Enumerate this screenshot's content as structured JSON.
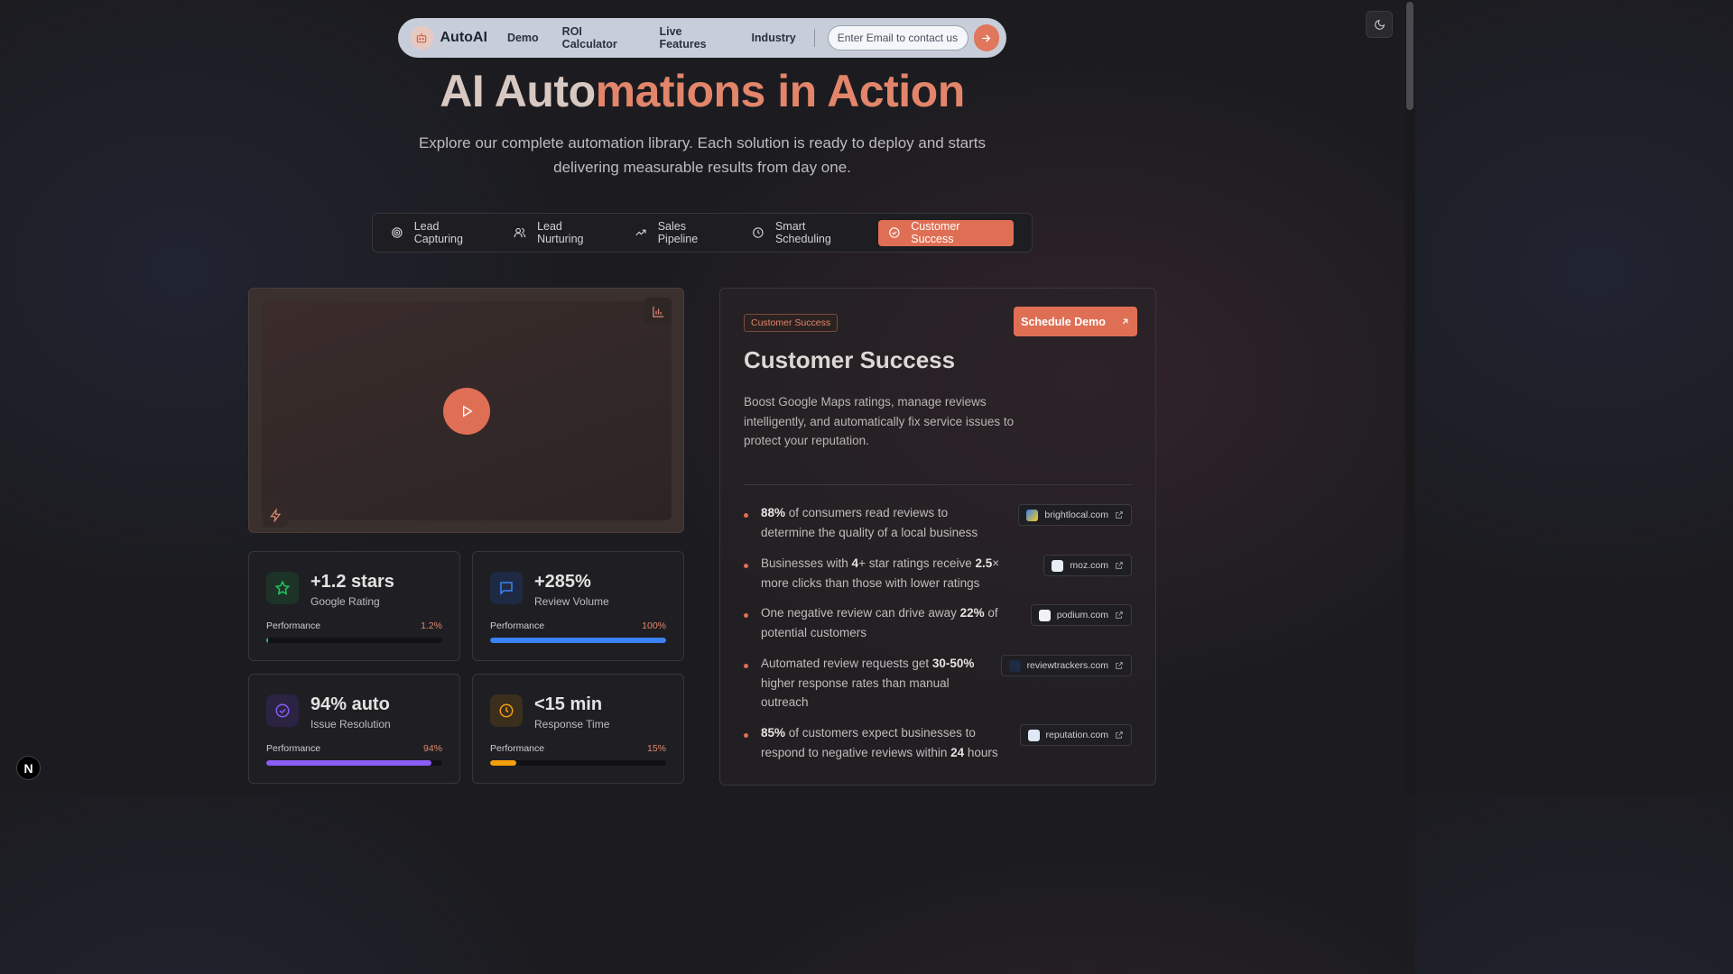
{
  "nav": {
    "brand": "AutoAI",
    "links": [
      "Demo",
      "ROI Calculator",
      "Live Features",
      "Industry"
    ],
    "email_placeholder": "Enter Email to contact us"
  },
  "hero": {
    "title_part1": "AI Auto",
    "title_part2": "mations in Action",
    "subtitle": "Explore our complete automation library. Each solution is ready to deploy and starts delivering measurable results from day one."
  },
  "tabs": [
    {
      "label": "Lead Capturing",
      "icon": "target-icon",
      "active": false
    },
    {
      "label": "Lead Nurturing",
      "icon": "users-icon",
      "active": false
    },
    {
      "label": "Sales Pipeline",
      "icon": "trending-up-icon",
      "active": false
    },
    {
      "label": "Smart Scheduling",
      "icon": "clock-icon",
      "active": false
    },
    {
      "label": "Customer Success",
      "icon": "check-circle-icon",
      "active": true
    }
  ],
  "metrics": [
    {
      "value": "+1.2 stars",
      "label": "Google Rating",
      "perf_label": "Performance",
      "perf_value": "1.2%",
      "fill": 0.012,
      "color": "#22c55e",
      "icon": "star-icon"
    },
    {
      "value": "+285%",
      "label": "Review Volume",
      "perf_label": "Performance",
      "perf_value": "100%",
      "fill": 1.0,
      "color": "#3b82f6",
      "icon": "message-icon"
    },
    {
      "value": "94% auto",
      "label": "Issue Resolution",
      "perf_label": "Performance",
      "perf_value": "94%",
      "fill": 0.94,
      "color": "#8b5cf6",
      "icon": "check-circle-icon"
    },
    {
      "value": "<15 min",
      "label": "Response Time",
      "perf_label": "Performance",
      "perf_value": "15%",
      "fill": 0.15,
      "color": "#f59e0b",
      "icon": "clock-icon"
    }
  ],
  "panel": {
    "pill": "Customer Success",
    "cta": "Schedule Demo",
    "title": "Customer Success",
    "description": "Boost Google Maps ratings, manage reviews intelligently, and automatically fix service issues to protect your reputation.",
    "stats": [
      {
        "parts": [
          [
            "b",
            "88%"
          ],
          [
            "t",
            " of consumers read reviews to determine the quality of a local business"
          ]
        ],
        "source": "brightlocal.com"
      },
      {
        "parts": [
          [
            "t",
            "Businesses with "
          ],
          [
            "b",
            "4"
          ],
          [
            "t",
            "+ star ratings receive "
          ],
          [
            "b",
            "2.5"
          ],
          [
            "t",
            "× more clicks than those with lower ratings"
          ]
        ],
        "source": "moz.com"
      },
      {
        "parts": [
          [
            "t",
            "One negative review can drive away "
          ],
          [
            "b",
            "22%"
          ],
          [
            "t",
            " of potential customers"
          ]
        ],
        "source": "podium.com"
      },
      {
        "parts": [
          [
            "t",
            "Automated review requests get "
          ],
          [
            "b",
            "30-50%"
          ],
          [
            "t",
            " higher response rates than manual outreach"
          ]
        ],
        "source": "reviewtrackers.com"
      },
      {
        "parts": [
          [
            "b",
            "85%"
          ],
          [
            "t",
            " of customers expect businesses to respond to negative reviews within "
          ],
          [
            "b",
            "24"
          ],
          [
            "t",
            " hours"
          ]
        ],
        "source": "reputation.com"
      }
    ]
  },
  "badge": "N"
}
